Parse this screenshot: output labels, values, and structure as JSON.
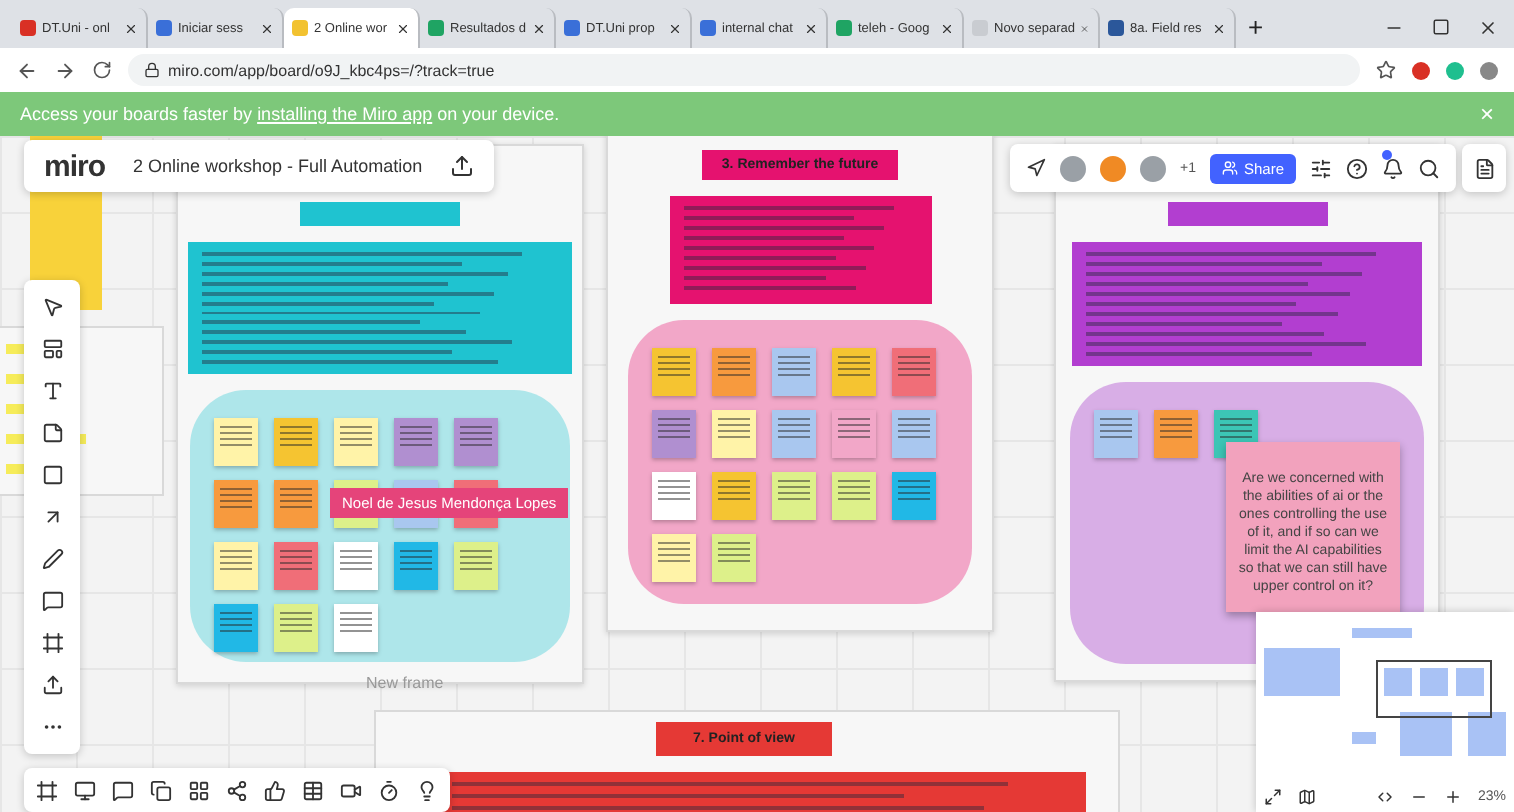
{
  "browser": {
    "tabs": [
      {
        "label": "DT.Uni - onl",
        "selected": false,
        "color": "#d93025"
      },
      {
        "label": "Iniciar sess",
        "selected": false,
        "color": "#3a6fd8"
      },
      {
        "label": "2 Online wor",
        "selected": true,
        "color": "#f2c230"
      },
      {
        "label": "Resultados d",
        "selected": false,
        "color": "#1fa463"
      },
      {
        "label": "DT.Uni prop",
        "selected": false,
        "color": "#3a6fd8"
      },
      {
        "label": "internal chat",
        "selected": false,
        "color": "#3a6fd8"
      },
      {
        "label": "teleh - Goog",
        "selected": false,
        "color": "#1fa463"
      },
      {
        "label": "Novo separad",
        "selected": false,
        "color": "#c9ccd1"
      },
      {
        "label": "8a. Field res",
        "selected": false,
        "color": "#2b579a"
      }
    ],
    "new_tab": "+",
    "url": "miro.com/app/board/o9J_kbc4ps=/?track=true"
  },
  "banner": {
    "before": "Access your boards faster by ",
    "link": "installing the Miro app",
    "after": " on your device.",
    "close": "×"
  },
  "board": {
    "logo": "miro",
    "title": "2 Online workshop - Full Automation",
    "extra_count": "+1",
    "share": "Share",
    "zoom": "23%",
    "collaborators": [
      {
        "color": "#9aa0a6"
      },
      {
        "color": "#f08a24"
      },
      {
        "color": "#9aa0a6"
      }
    ]
  },
  "frames": [
    {
      "color": "#1fc3d0",
      "cluster": {
        "color": "#aee6ea",
        "notes": [
          {
            "color": "#fff3a8"
          },
          {
            "color": "#f5c431"
          },
          {
            "color": "#fff3a8"
          },
          {
            "color": "#b08fd0"
          },
          {
            "color": "#b08fd0"
          },
          {
            "color": "#f79a3e"
          },
          {
            "color": "#f79a3e"
          },
          {
            "color": "#ddf08a"
          },
          {
            "color": "#a9c7ef"
          },
          {
            "color": "#f06e78"
          },
          {
            "color": "#fff3a8"
          },
          {
            "color": "#f06e78"
          },
          {
            "color": "#ffffff"
          },
          {
            "color": "#21b8e6"
          },
          {
            "color": "#ddf08a"
          },
          {
            "color": "#21b8e6"
          },
          {
            "color": "#ddf08a"
          },
          {
            "color": "#ffffff"
          }
        ]
      }
    },
    {
      "color": "#e5126f",
      "heading": "3. Remember the future",
      "cluster": {
        "color": "#f2a7c8",
        "notes": [
          {
            "color": "#f5c431"
          },
          {
            "color": "#f79a3e"
          },
          {
            "color": "#a9c7ef"
          },
          {
            "color": "#f5c431"
          },
          {
            "color": "#f06e78"
          },
          {
            "color": "#b08fd0"
          },
          {
            "color": "#fff3a8"
          },
          {
            "color": "#a9c7ef"
          },
          {
            "color": "#f2a7c8"
          },
          {
            "color": "#a9c7ef"
          },
          {
            "color": "#ffffff"
          },
          {
            "color": "#f5c431"
          },
          {
            "color": "#ddf08a"
          },
          {
            "color": "#ddf08a"
          },
          {
            "color": "#21b8e6"
          },
          {
            "color": "#fff3a8"
          },
          {
            "color": "#ddf08a"
          }
        ]
      }
    },
    {
      "color": "#b23ed0",
      "cluster": {
        "color": "#d8aee6",
        "notes": [
          {
            "color": "#a9c7ef"
          },
          {
            "color": "#f79a3e"
          },
          {
            "color": "#3cc5b5"
          }
        ],
        "featured_note": "Are we concerned with the abilities of ai or the ones controlling the use of it, and if so can we limit the AI capabilities so that we can still have upper control on it?"
      }
    }
  ],
  "frame_label": "New frame",
  "cursor_tag": "Noel de Jesus Mendonça Lopes",
  "bottom_frame": {
    "heading": "7. Point of view"
  }
}
